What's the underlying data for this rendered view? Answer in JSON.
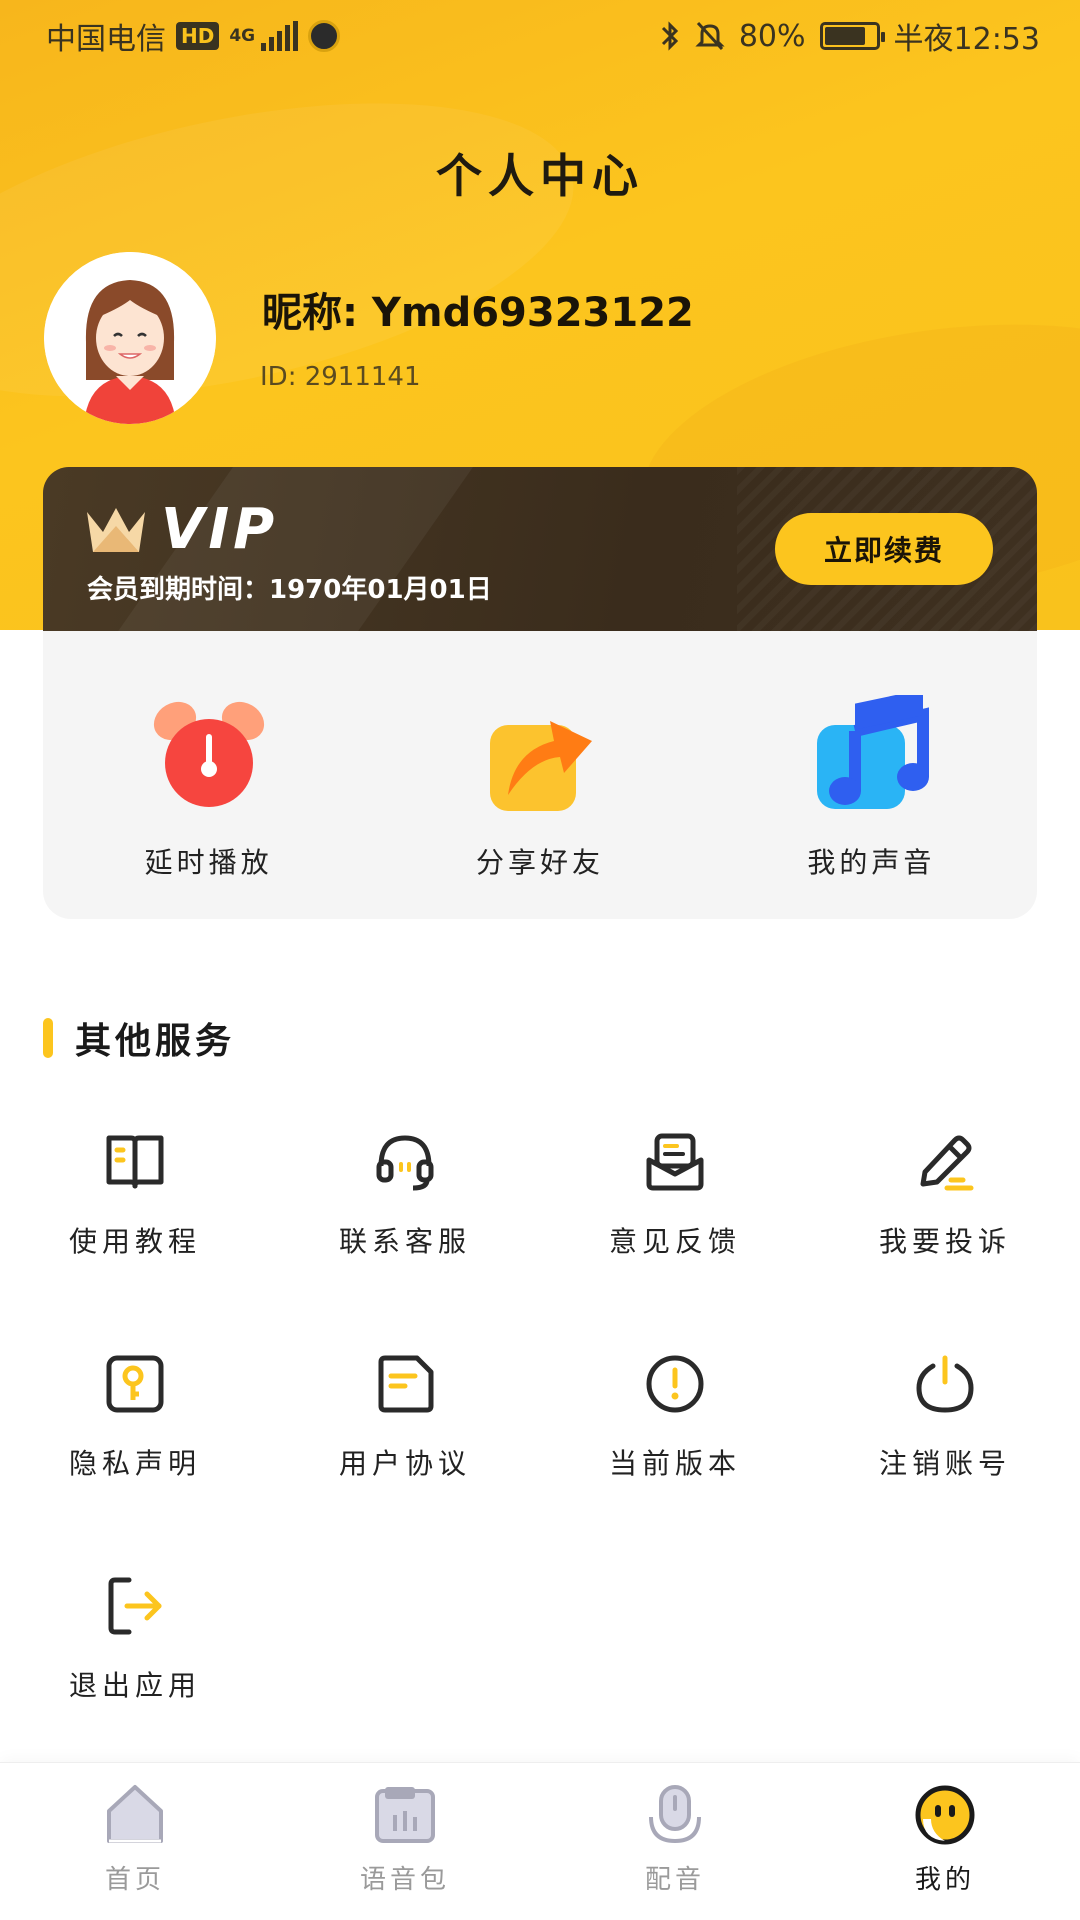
{
  "status_bar": {
    "carrier": "中国电信",
    "hd": "HD",
    "network": "4G",
    "battery_percent": "80%",
    "time": "半夜12:53"
  },
  "header": {
    "title": "个人中心"
  },
  "profile": {
    "nickname": "昵称: Ymd69323122",
    "id": "ID: 2911141"
  },
  "vip": {
    "badge": "VIP",
    "expiry": "会员到期时间：1970年01月01日",
    "renew_label": "立即续费"
  },
  "quick_tools": [
    {
      "label": "延时播放",
      "icon": "alarm-clock-icon"
    },
    {
      "label": "分享好友",
      "icon": "share-arrow-icon"
    },
    {
      "label": "我的声音",
      "icon": "music-note-icon"
    }
  ],
  "other_services": {
    "title": "其他服务",
    "items": [
      {
        "label": "使用教程",
        "icon": "book-icon"
      },
      {
        "label": "联系客服",
        "icon": "headset-icon"
      },
      {
        "label": "意见反馈",
        "icon": "mail-feedback-icon"
      },
      {
        "label": "我要投诉",
        "icon": "pencil-icon"
      },
      {
        "label": "隐私声明",
        "icon": "key-icon"
      },
      {
        "label": "用户协议",
        "icon": "document-icon"
      },
      {
        "label": "当前版本",
        "icon": "info-circle-icon"
      },
      {
        "label": "注销账号",
        "icon": "power-icon"
      },
      {
        "label": "退出应用",
        "icon": "logout-icon"
      }
    ]
  },
  "bottom_nav": [
    {
      "label": "首页",
      "icon": "home-icon",
      "active": false
    },
    {
      "label": "语音包",
      "icon": "voice-pack-icon",
      "active": false
    },
    {
      "label": "配音",
      "icon": "microphone-icon",
      "active": false
    },
    {
      "label": "我的",
      "icon": "smiley-icon",
      "active": true
    }
  ],
  "colors": {
    "accent": "#fcc51e",
    "vip_card": "#3a2c1c",
    "icon_dark": "#2a2a2a"
  }
}
